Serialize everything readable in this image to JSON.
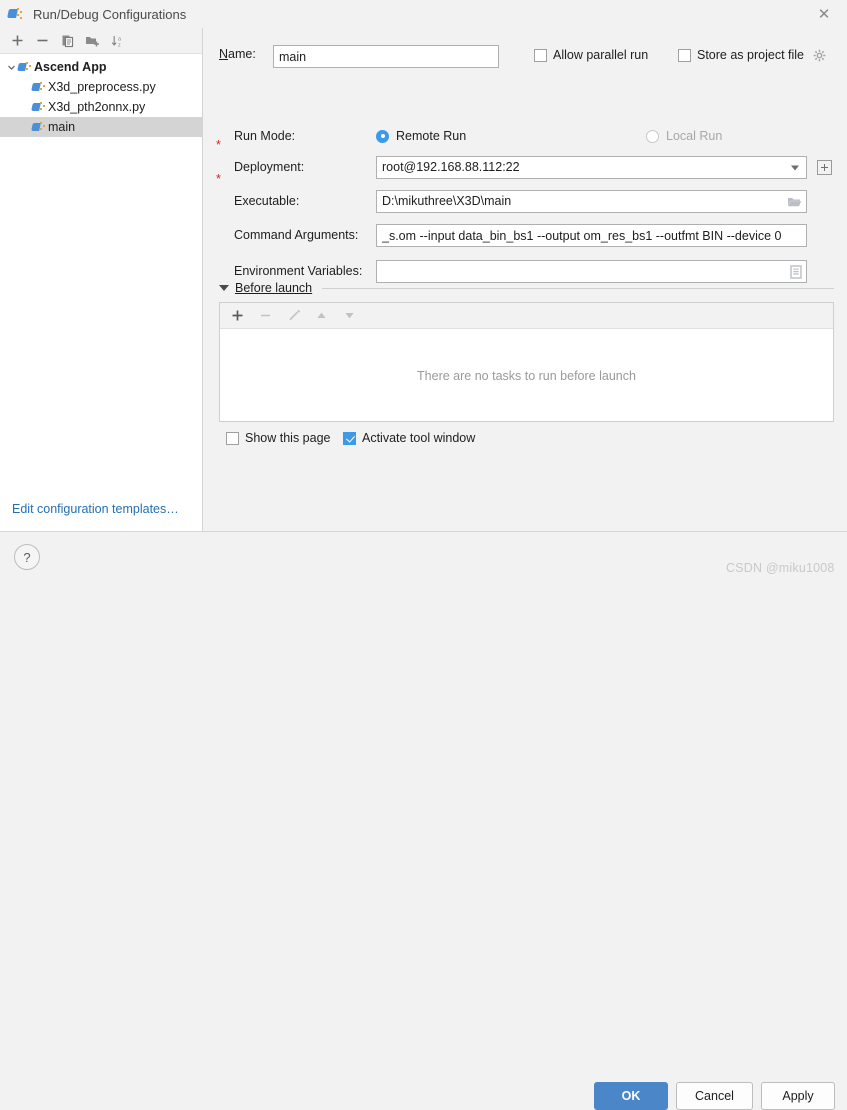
{
  "window": {
    "title": "Run/Debug Configurations",
    "title_icon": "ascend-app-icon",
    "close_label": "✕"
  },
  "sidebar": {
    "toolbar": [
      {
        "name": "add-configuration-button",
        "icon": "plus-icon"
      },
      {
        "name": "remove-configuration-button",
        "icon": "minus-icon"
      },
      {
        "name": "copy-configuration-button",
        "icon": "copy-icon"
      },
      {
        "name": "new-folder-button",
        "icon": "folder-add-icon"
      },
      {
        "name": "sort-configurations-button",
        "icon": "sort-alpha-icon"
      }
    ],
    "tree": [
      {
        "label": "Ascend App",
        "level": 0,
        "bold": true,
        "expanded": true,
        "selected": false
      },
      {
        "label": "X3d_preprocess.py",
        "level": 1,
        "bold": false,
        "selected": false
      },
      {
        "label": "X3d_pth2onnx.py",
        "level": 1,
        "bold": false,
        "selected": false
      },
      {
        "label": "main",
        "level": 1,
        "bold": false,
        "selected": true
      }
    ],
    "templates_link": "Edit configuration templates…"
  },
  "form": {
    "name_label": "Name:",
    "name_label_mnemonic": "N",
    "name_value": "main",
    "allow_parallel_run": {
      "label": "Allow parallel run",
      "checked": false
    },
    "store_as_project_file": {
      "label": "Store as project file",
      "checked": false,
      "gear_icon": "gear-icon"
    },
    "run_mode_label": "Run Mode:",
    "run_mode_options": [
      {
        "label": "Remote Run",
        "selected": true,
        "disabled": false
      },
      {
        "label": "Local Run",
        "selected": false,
        "disabled": true
      }
    ],
    "deployment_label": "Deployment:",
    "deployment_required": "*",
    "deployment_value": "root@192.168.88.112:22",
    "deployment_add_button": "add-deployment-button",
    "executable_label": "Executable:",
    "executable_required": "*",
    "executable_value": "D:\\mikuthree\\X3D\\main",
    "executable_browse_icon": "folder-open-icon",
    "command_arguments_label": "Command Arguments:",
    "command_arguments_value": "_s.om --input data_bin_bs1 --output om_res_bs1 --outfmt BIN --device 0",
    "environment_variables_label": "Environment Variables:",
    "environment_variables_value": "",
    "environment_variables_icon": "list-edit-icon"
  },
  "before_launch": {
    "title": "Before launch",
    "toolbar": [
      {
        "name": "add-task-button",
        "icon": "plus-icon",
        "enabled": true
      },
      {
        "name": "remove-task-button",
        "icon": "minus-icon",
        "enabled": false
      },
      {
        "name": "edit-task-button",
        "icon": "pencil-icon",
        "enabled": false
      },
      {
        "name": "move-task-up-button",
        "icon": "triangle-up-icon",
        "enabled": false
      },
      {
        "name": "move-task-down-button",
        "icon": "triangle-down-icon",
        "enabled": false
      }
    ],
    "empty_text": "There are no tasks to run before launch",
    "show_this_page": {
      "label": "Show this page",
      "checked": false
    },
    "activate_tool_window": {
      "label": "Activate tool window",
      "checked": true
    }
  },
  "footer": {
    "help_label": "?",
    "ok_label": "OK",
    "cancel_label": "Cancel",
    "apply_label": "Apply"
  },
  "watermark": "CSDN @miku1008",
  "colors": {
    "accent": "#4a86c8",
    "checkbox_checked": "#3d9ae8",
    "link": "#2470b3",
    "required_star": "#cc2b2b",
    "selection": "#d4d4d4",
    "panel_bg": "#f2f2f2"
  }
}
